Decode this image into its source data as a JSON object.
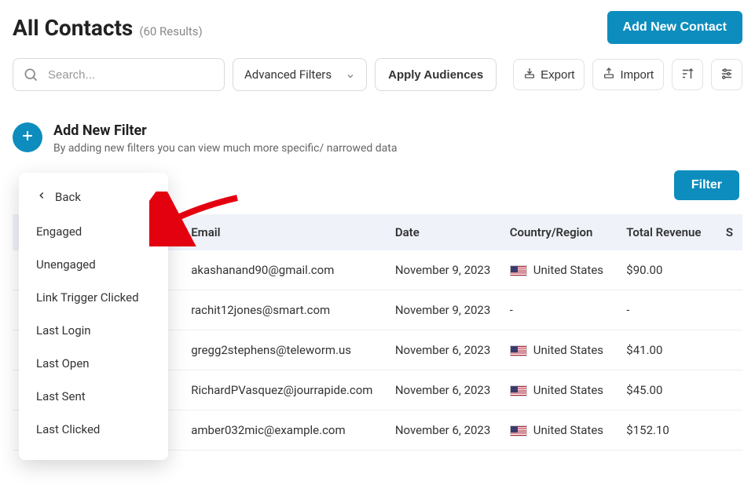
{
  "header": {
    "title": "All Contacts",
    "resultCount": "(60 Results)",
    "addBtn": "Add New Contact"
  },
  "toolbar": {
    "searchPlaceholder": "Search...",
    "advancedFilters": "Advanced Filters",
    "applyAudiences": "Apply Audiences",
    "export": "Export",
    "import": "Import"
  },
  "addFilter": {
    "title": "Add New Filter",
    "subtitle": "By adding new filters you can view much more specific/ narrowed data"
  },
  "filterBtn": "Filter",
  "dropdown": {
    "back": "Back",
    "items": [
      "Engaged",
      "Unengaged",
      "Link Trigger Clicked",
      "Last Login",
      "Last Open",
      "Last Sent",
      "Last Clicked"
    ]
  },
  "table": {
    "headers": {
      "email": "Email",
      "date": "Date",
      "country": "Country/Region",
      "revenue": "Total Revenue",
      "extra": "S"
    },
    "rows": [
      {
        "email": "akashanand90@gmail.com",
        "date": "November 9, 2023",
        "country": "United States",
        "flag": true,
        "revenue": "$90.00"
      },
      {
        "email": "rachit12jones@smart.com",
        "date": "November 9, 2023",
        "country": "-",
        "flag": false,
        "revenue": "-"
      },
      {
        "email": "gregg2stephens@teleworm.us",
        "date": "November 6, 2023",
        "country": "United States",
        "flag": true,
        "revenue": "$41.00"
      },
      {
        "email": "RichardPVasquez@jourrapide.com",
        "date": "November 6, 2023",
        "country": "United States",
        "flag": true,
        "revenue": "$45.00"
      },
      {
        "email": "amber032mic@example.com",
        "date": "November 6, 2023",
        "country": "United States",
        "flag": true,
        "revenue": "$152.10"
      }
    ]
  }
}
